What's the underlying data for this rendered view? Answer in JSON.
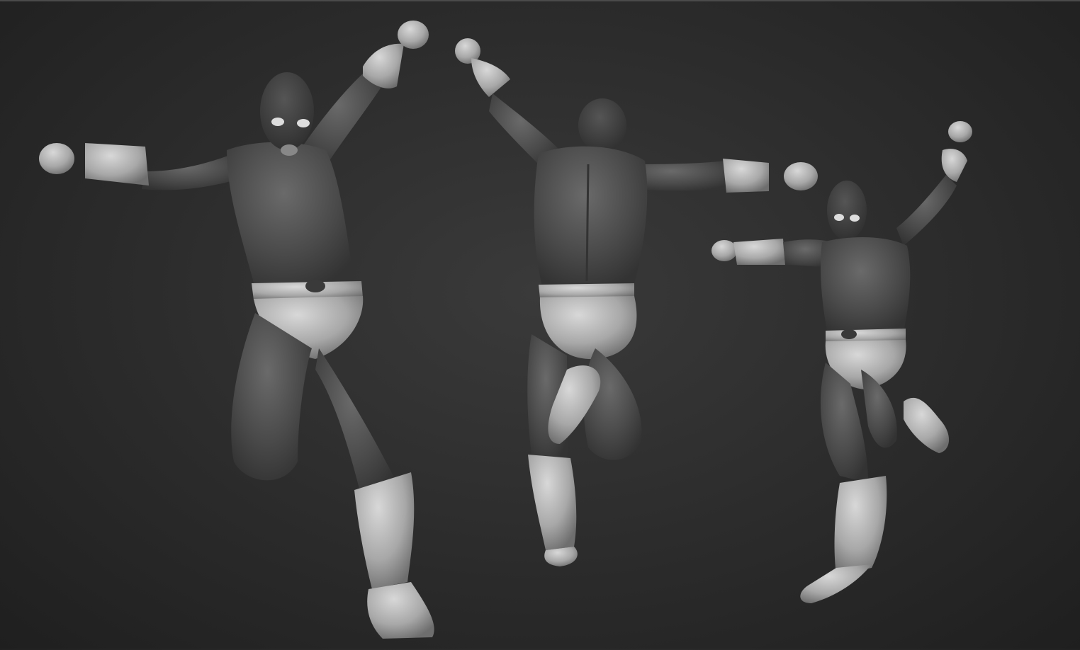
{
  "viewport": {
    "background_color": "#2d2d2d",
    "material_dark": "#4a4a4a",
    "material_light": "#b8b8b8",
    "views": [
      {
        "name": "front-view",
        "pose": "front"
      },
      {
        "name": "back-view",
        "pose": "back"
      },
      {
        "name": "three-quarter-view",
        "pose": "three-quarter"
      }
    ]
  }
}
